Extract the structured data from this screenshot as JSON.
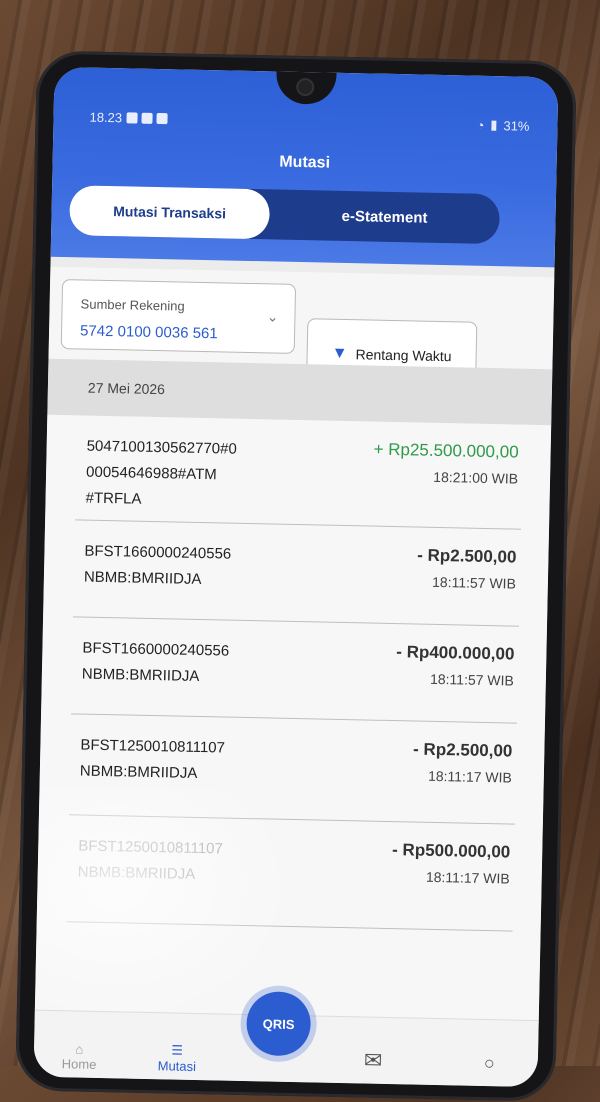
{
  "status_bar": {
    "time": "18.23",
    "battery": "31%"
  },
  "header": {
    "title": "Mutasi"
  },
  "tabs": [
    {
      "label": "Mutasi Transaksi",
      "active": true
    },
    {
      "label": "e-Statement",
      "active": false
    }
  ],
  "filters": {
    "source_label": "Sumber Rekening",
    "source_value": "5742 0100 0036 561",
    "time_label": "Rentang Waktu"
  },
  "date_header": "27 Mei 2026",
  "transactions": [
    {
      "desc": "5047100130562770#0\n00054646988#ATM\n#TRFLA",
      "amount": "+ Rp25.500.000,00",
      "time": "18:21:00 WIB",
      "type": "credit"
    },
    {
      "desc": "BFST1660000240556\nNBMB:BMRIIDJA",
      "amount": "- Rp2.500,00",
      "time": "18:11:57 WIB",
      "type": "debit"
    },
    {
      "desc": "BFST1660000240556\nNBMB:BMRIIDJA",
      "amount": "- Rp400.000,00",
      "time": "18:11:57 WIB",
      "type": "debit"
    },
    {
      "desc": "BFST1250010811107\nNBMB:BMRIIDJA",
      "amount": "- Rp2.500,00",
      "time": "18:11:17 WIB",
      "type": "debit"
    },
    {
      "desc": "BFST1250010811107\nNBMB:BMRIIDJA",
      "amount": "- Rp500.000,00",
      "time": "18:11:17 WIB",
      "type": "debit"
    }
  ],
  "bottom_nav": {
    "home": "Home",
    "mutasi": "Mutasi",
    "qris": "QRIS"
  },
  "colors": {
    "primary": "#2c5dd0",
    "credit": "#2f9a4a"
  }
}
